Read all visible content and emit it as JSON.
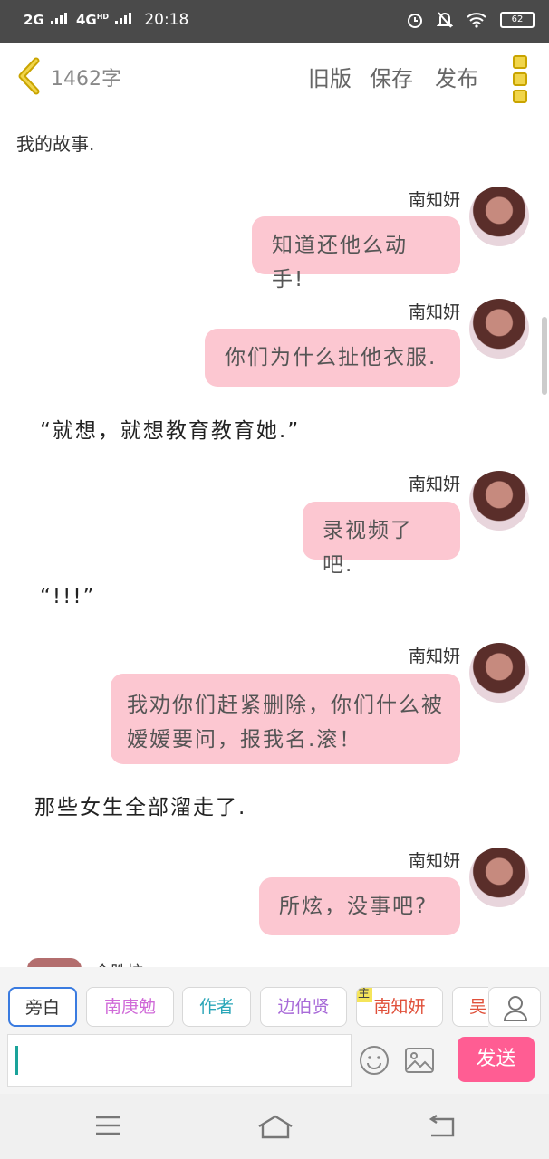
{
  "status_bar": {
    "network_1": "2G",
    "network_2": "4G",
    "network_2_sup": "HD",
    "time": "20:18",
    "battery": "62"
  },
  "header": {
    "word_count": "1462字",
    "old_version": "旧版",
    "save": "保存",
    "publish": "发布"
  },
  "story_title": "我的故事.",
  "messages": [
    {
      "name": "南知妍",
      "text": "知道还他么动手!"
    },
    {
      "name": "南知妍",
      "text": "你们为什么扯他衣服."
    },
    {
      "narration": "“就想，就想教育教育她.”"
    },
    {
      "name": "南知妍",
      "text": "录视频了吧."
    },
    {
      "narration": "“!!!”"
    },
    {
      "name": "南知妍",
      "text": "我劝你们赶紧删除，你们什么被嫒嫒要问，报我名.滚！"
    },
    {
      "narration": "那些女生全部溜走了."
    },
    {
      "name": "南知妍",
      "text": "所炫，没事吧?"
    }
  ],
  "partial_next_name": "金胜炫",
  "roles": [
    {
      "label": "旁白",
      "color": "#555555",
      "selected": true
    },
    {
      "label": "南庚勉",
      "color": "#d06ad8"
    },
    {
      "label": "作者",
      "color": "#2aa6b8"
    },
    {
      "label": "边伯贤",
      "color": "#a86ad8"
    },
    {
      "label": "南知妍",
      "color": "#e0503a",
      "tag": "主"
    },
    {
      "label": "吴",
      "color": "#e0503a"
    }
  ],
  "composer": {
    "send_label": "发送",
    "value": ""
  },
  "colors": {
    "bubble": "#fcc7d1",
    "send": "#ff5d93",
    "status_bar": "#4a4a4a",
    "accent_menu": "#f1d54a"
  }
}
